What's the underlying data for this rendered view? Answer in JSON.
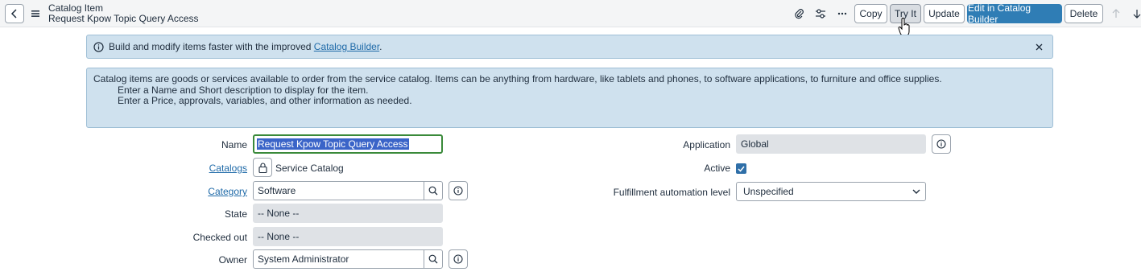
{
  "header": {
    "breadcrumb": "Catalog Item",
    "title": "Request Kpow Topic Query Access",
    "buttons": {
      "copy": "Copy",
      "try_it": "Try It",
      "update": "Update",
      "edit_builder": "Edit in Catalog Builder",
      "delete": "Delete"
    },
    "icons": [
      "back-icon",
      "menu-icon",
      "attachment-icon",
      "settings-sliders-icon",
      "more-icon",
      "arrow-up-icon",
      "arrow-down-icon"
    ]
  },
  "banner": {
    "text_before": "Build and modify items faster with the improved ",
    "link": "Catalog Builder",
    "text_after": "."
  },
  "info": {
    "line1": "Catalog items are goods or services available to order from the service catalog. Items can be anything from hardware, like tablets and phones, to software applications, to furniture and office supplies.",
    "line2": "Enter a Name and Short description to display for the item.",
    "line3": "Enter a Price, approvals, variables, and other information as needed."
  },
  "form": {
    "name": {
      "label": "Name",
      "value": "Request Kpow Topic Query Access"
    },
    "catalogs": {
      "label": "Catalogs",
      "value": "Service Catalog"
    },
    "category": {
      "label": "Category",
      "value": "Software"
    },
    "state": {
      "label": "State",
      "value": "-- None --"
    },
    "checked_out": {
      "label": "Checked out",
      "value": "-- None --"
    },
    "owner": {
      "label": "Owner",
      "value": "System Administrator"
    },
    "application": {
      "label": "Application",
      "value": "Global"
    },
    "active": {
      "label": "Active",
      "checked": true
    },
    "fulfillment": {
      "label": "Fulfillment automation level",
      "value": "Unspecified"
    }
  },
  "colors": {
    "primary_button": "#2f7db5",
    "banner_bg": "#cfe1ee",
    "link": "#1f6aa8",
    "focus_border": "#3a8a3a"
  }
}
